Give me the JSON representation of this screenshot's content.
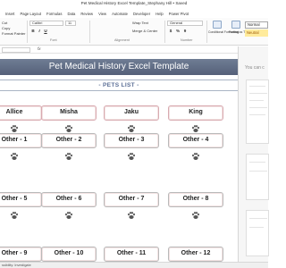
{
  "window": {
    "title": "Pet Medical History Excel Template_Stephany Hill • Saved"
  },
  "menu": [
    "Insert",
    "Page Layout",
    "Formulas",
    "Data",
    "Review",
    "View",
    "Automate",
    "Developer",
    "Help",
    "Power Pivot"
  ],
  "ribbon": {
    "font_name": "Calibri",
    "font_size": "11",
    "cut": "Cut",
    "copy": "Copy",
    "format_painter": "Format Painter",
    "wrap_text": "Wrap Text",
    "merge_center": "Merge & Center",
    "number_format": "General",
    "conditional_formatting": "Conditional Formatting",
    "format_as_table": "Format as Table",
    "style_normal": "Normal",
    "style_neutral": "Neutral",
    "group_font": "Font",
    "group_alignment": "Alignment",
    "group_number": "Number",
    "bold": "B",
    "italic": "I",
    "underline": "U",
    "currency": "$",
    "percent": "%",
    "comma": "9"
  },
  "formula_bar": {
    "fx": "fx"
  },
  "sheet": {
    "banner_title": "Pet Medical History Excel Template",
    "section_label": "- PETS LIST -",
    "pets": [
      [
        "Allice",
        "Misha",
        "Jaku",
        "King"
      ],
      [
        "Other - 1",
        "Other - 2",
        "Other - 3",
        "Other - 4"
      ],
      [
        "Other - 5",
        "Other - 6",
        "Other - 7",
        "Other - 8"
      ],
      [
        "Other - 9",
        "Other - 10",
        "Other - 11",
        "Other - 12"
      ]
    ]
  },
  "task_pane": {
    "hint": "You can c"
  },
  "status_bar": {
    "text": "ssibility: Investigate"
  },
  "colors": {
    "banner": "#5f6b84",
    "section_text": "#5c6f96",
    "neutral_fill": "#ffeb9c",
    "card_border_named": "#d8aab0"
  }
}
